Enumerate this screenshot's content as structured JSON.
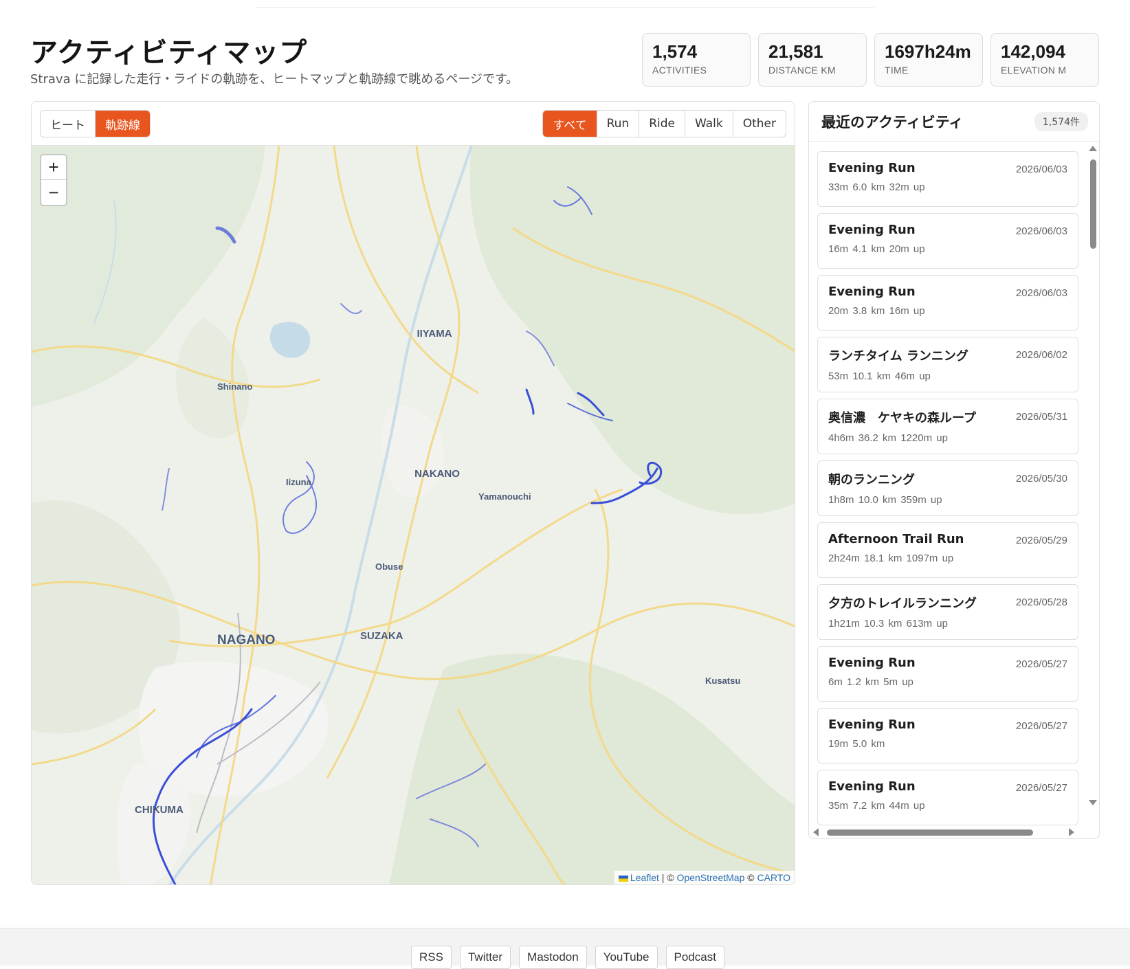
{
  "header": {
    "title": "アクティビティマップ",
    "subtitle": "Strava に記録した走行・ライドの軌跡を、ヒートマップと軌跡線で眺めるページです。"
  },
  "stats": [
    {
      "value": "1,574",
      "label": "ACTIVITIES"
    },
    {
      "value": "21,581",
      "label": "DISTANCE KM"
    },
    {
      "value": "1697h24m",
      "label": "TIME"
    },
    {
      "value": "142,094",
      "label": "ELEVATION M"
    }
  ],
  "map": {
    "view_modes": [
      {
        "label": "ヒート",
        "active": false
      },
      {
        "label": "軌跡線",
        "active": true
      }
    ],
    "filters": [
      {
        "label": "すべて",
        "active": true
      },
      {
        "label": "Run",
        "active": false
      },
      {
        "label": "Ride",
        "active": false
      },
      {
        "label": "Walk",
        "active": false
      },
      {
        "label": "Other",
        "active": false
      }
    ],
    "zoom_in": "+",
    "zoom_out": "−",
    "places": {
      "iiyama": "IIYAMA",
      "shinano": "Shinano",
      "nakano": "NAKANO",
      "yamanouchi": "Yamanouchi",
      "iizuna": "Iizuna",
      "obuse": "Obuse",
      "nagano": "NAGANO",
      "suzaka": "SUZAKA",
      "kusatsu": "Kusatsu",
      "chikuma": "CHIKUMA"
    },
    "attribution": {
      "leaflet": "Leaflet",
      "sep": " | © ",
      "osm": "OpenStreetMap",
      "copy": " © ",
      "carto": "CARTO"
    },
    "colors": {
      "accent": "#e8551e",
      "track": "#3a4fd8",
      "road": "#f3d98a"
    }
  },
  "sidebar": {
    "title": "最近のアクティビティ",
    "count": "1,574件",
    "activities": [
      {
        "name": "Evening Run",
        "date": "2026/06/03",
        "meta": "33m  6.0 km  32m up"
      },
      {
        "name": "Evening Run",
        "date": "2026/06/03",
        "meta": "16m  4.1 km  20m up"
      },
      {
        "name": "Evening Run",
        "date": "2026/06/03",
        "meta": "20m  3.8 km  16m up"
      },
      {
        "name": "ランチタイム ランニング",
        "date": "2026/06/02",
        "meta": "53m  10.1 km  46m up"
      },
      {
        "name": "奥信濃　ケヤキの森ループ",
        "date": "2026/05/31",
        "meta": "4h6m  36.2 km  1220m up"
      },
      {
        "name": "朝のランニング",
        "date": "2026/05/30",
        "meta": "1h8m  10.0 km  359m up"
      },
      {
        "name": "Afternoon Trail Run",
        "date": "2026/05/29",
        "meta": "2h24m  18.1 km  1097m up"
      },
      {
        "name": "夕方のトレイルランニング",
        "date": "2026/05/28",
        "meta": "1h21m  10.3 km  613m up"
      },
      {
        "name": "Evening Run",
        "date": "2026/05/27",
        "meta": "6m  1.2 km  5m up"
      },
      {
        "name": "Evening Run",
        "date": "2026/05/27",
        "meta": "19m  5.0 km"
      },
      {
        "name": "Evening Run",
        "date": "2026/05/27",
        "meta": "35m  7.2 km  44m up"
      }
    ]
  },
  "footer": {
    "links": [
      "RSS",
      "Twitter",
      "Mastodon",
      "YouTube",
      "Podcast"
    ]
  }
}
